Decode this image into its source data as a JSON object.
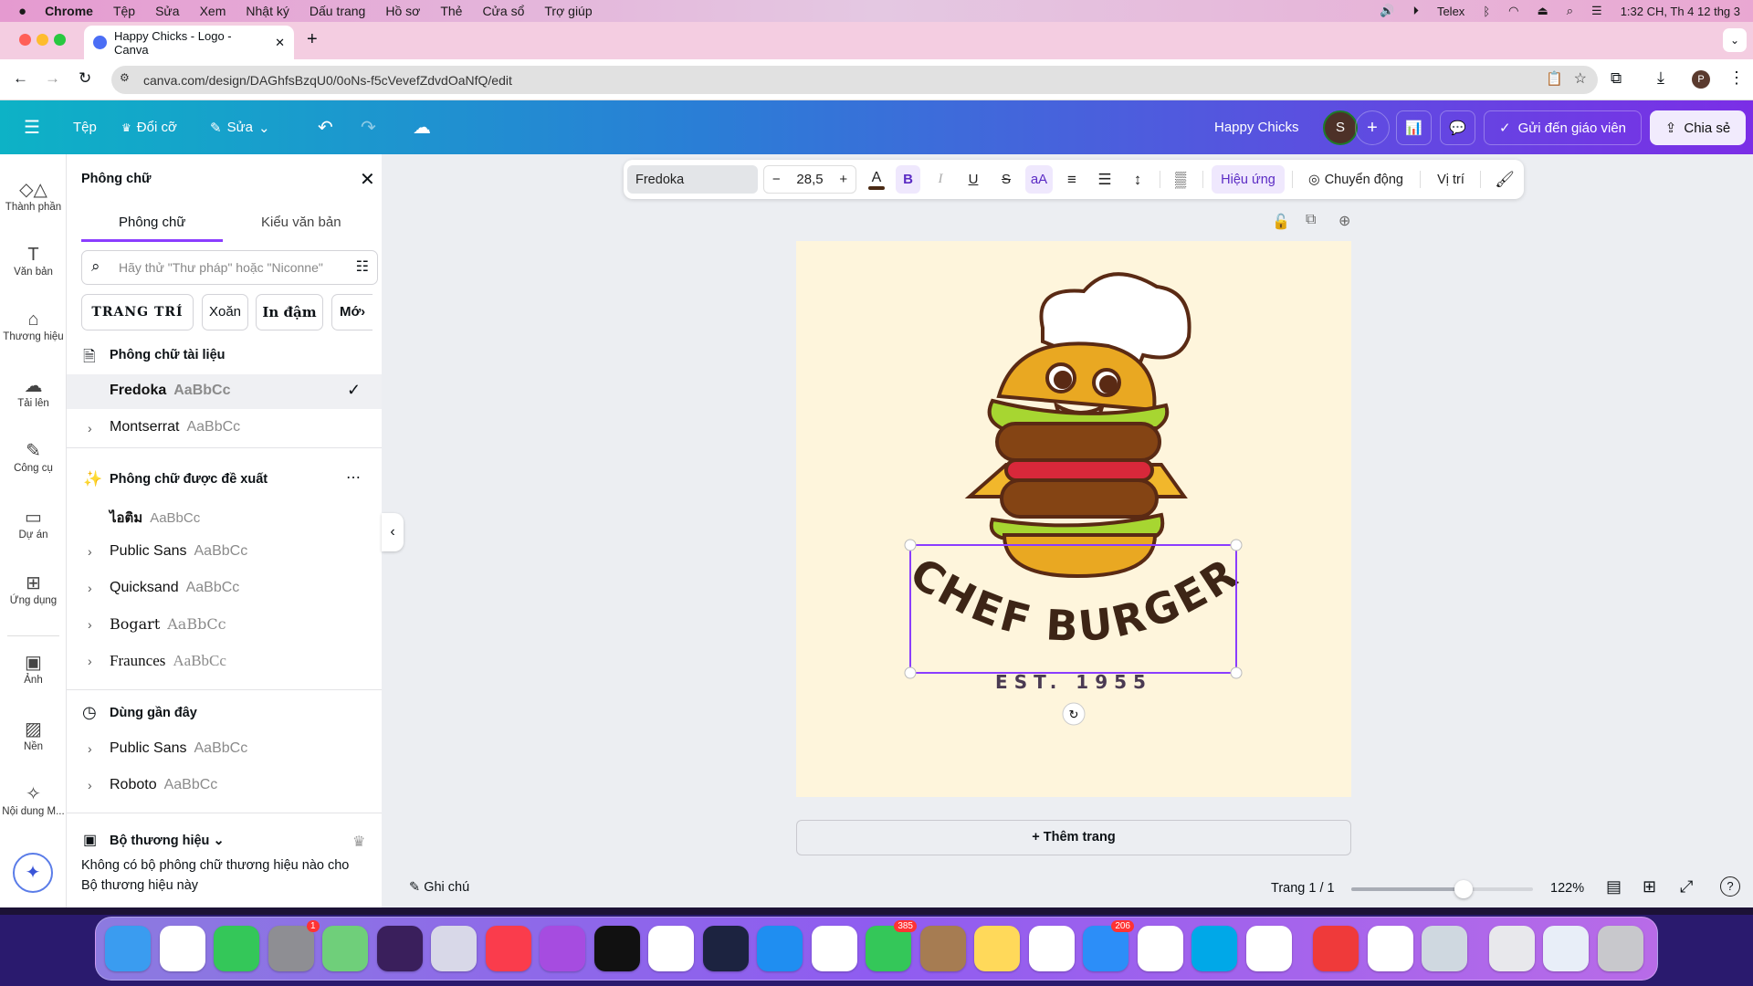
{
  "menubar": {
    "app": "Chrome",
    "items": [
      "Tệp",
      "Sửa",
      "Xem",
      "Nhật ký",
      "Dấu trang",
      "Hồ sơ",
      "Thẻ",
      "Cửa sổ",
      "Trợ giúp"
    ],
    "input_method": "Telex",
    "clock": "1:32 CH, Th 4 12 thg 3"
  },
  "browser": {
    "tab_title": "Happy Chicks - Logo - Canva",
    "url": "canva.com/design/DAGhfsBzqU0/0oNs-f5cVevefZdvdOaNfQ/edit",
    "profile": "P"
  },
  "header": {
    "file": "Tệp",
    "resize": "Đổi cỡ",
    "edit": "Sửa",
    "design_title": "Happy Chicks",
    "avatar": "S",
    "send_teacher": "Gửi đến giáo viên",
    "share": "Chia sẻ"
  },
  "rail": [
    {
      "label": "Thành phần",
      "icon": "elements"
    },
    {
      "label": "Văn bản",
      "icon": "text"
    },
    {
      "label": "Thương hiệu",
      "icon": "brand"
    },
    {
      "label": "Tải lên",
      "icon": "upload"
    },
    {
      "label": "Công cụ",
      "icon": "tools"
    },
    {
      "label": "Dự án",
      "icon": "folder"
    },
    {
      "label": "Ứng dụng",
      "icon": "apps"
    },
    {
      "label": "Ảnh",
      "icon": "photo"
    },
    {
      "label": "Nền",
      "icon": "background"
    },
    {
      "label": "Nội dung M...",
      "icon": "magic-media"
    }
  ],
  "panel": {
    "title": "Phông chữ",
    "tabs": [
      "Phông chữ",
      "Kiểu văn bản"
    ],
    "search_placeholder": "Hãy thử \"Thư pháp\" hoặc \"Niconne\"",
    "chips": [
      "TRANG TRÍ",
      "Xoăn",
      "In đậm",
      "Mớ"
    ],
    "doc_fonts_title": "Phông chữ tài liệu",
    "doc_fonts": [
      {
        "name": "Fredoka",
        "sample": "AaBbCc",
        "selected": true
      },
      {
        "name": "Montserrat",
        "sample": "AaBbCc"
      }
    ],
    "suggested_title": "Phông chữ được đề xuất",
    "suggested": [
      {
        "name": "ไอติม",
        "sample": "AaBbCc"
      },
      {
        "name": "Public Sans",
        "sample": "AaBbCc"
      },
      {
        "name": "Quicksand",
        "sample": "AaBbCc"
      },
      {
        "name": "Bogart",
        "sample": "AaBbCc"
      },
      {
        "name": "Fraunces",
        "sample": "AaBbCc"
      }
    ],
    "recent_title": "Dùng gần đây",
    "recent": [
      {
        "name": "Public Sans",
        "sample": "AaBbCc"
      },
      {
        "name": "Roboto",
        "sample": "AaBbCc"
      }
    ],
    "brand_title": "Bộ thương hiệu",
    "brand_desc": "Không có bộ phông chữ thương hiệu nào cho Bộ thương hiệu này"
  },
  "toolbar": {
    "font": "Fredoka",
    "size": "28,5",
    "minus": "−",
    "plus": "+",
    "bold": "B",
    "italic": "I",
    "underline": "U",
    "strike": "S",
    "case": "aA",
    "effects": "Hiệu ứng",
    "animate": "Chuyển động",
    "position": "Vị trí",
    "text_color": "#4a2a14"
  },
  "canvas": {
    "headline": "CHEF BURGER",
    "subline": "EST. 1955",
    "background": "#fef5dc",
    "text_color": "#3d2516"
  },
  "add_page": "+ Thêm trang",
  "footer": {
    "notes": "Ghi chú",
    "page": "Trang 1 / 1",
    "zoom": "122%",
    "zoom_slider_fraction": 0.62
  },
  "dock": [
    {
      "app": "Finder",
      "color": "#3a9cf0"
    },
    {
      "app": "Chrome",
      "color": "#ffffff"
    },
    {
      "app": "FaceTime",
      "color": "#34c759"
    },
    {
      "app": "System Settings",
      "color": "#8e8e93",
      "badge": "1"
    },
    {
      "app": "Maps",
      "color": "#6fcf7a"
    },
    {
      "app": "Siri",
      "color": "#3a1f5c"
    },
    {
      "app": "Launchpad",
      "color": "#d8d8e8"
    },
    {
      "app": "Music",
      "color": "#fa3c4c"
    },
    {
      "app": "Podcasts",
      "color": "#a64ce0"
    },
    {
      "app": "Apple TV",
      "color": "#111111"
    },
    {
      "app": "Safari",
      "color": "#ffffff"
    },
    {
      "app": "Font App",
      "color": "#1c2340"
    },
    {
      "app": "App Store",
      "color": "#1f8ef1"
    },
    {
      "app": "Photos",
      "color": "#ffffff"
    },
    {
      "app": "Messages",
      "color": "#34c759",
      "badge": "385"
    },
    {
      "app": "Contacts",
      "color": "#a67c52"
    },
    {
      "app": "Notes",
      "color": "#ffd95a"
    },
    {
      "app": "Reminders",
      "color": "#ffffff"
    },
    {
      "app": "Mail",
      "color": "#2c8ef8",
      "badge": "206"
    },
    {
      "app": "Zalo",
      "color": "#ffffff"
    },
    {
      "app": "Skype",
      "color": "#00a8e8"
    },
    {
      "app": "Vbee",
      "color": "#ffffff"
    },
    {
      "app": "AnyDesk",
      "color": "#ef3a3a"
    },
    {
      "app": "Zalo",
      "color": "#ffffff"
    },
    {
      "app": "Preview",
      "color": "#cfd8e0"
    },
    {
      "app": "Document",
      "color": "#e8e8ec"
    },
    {
      "app": "Document",
      "color": "#e8eef8"
    },
    {
      "app": "Trash",
      "color": "#c8c8cc"
    }
  ]
}
